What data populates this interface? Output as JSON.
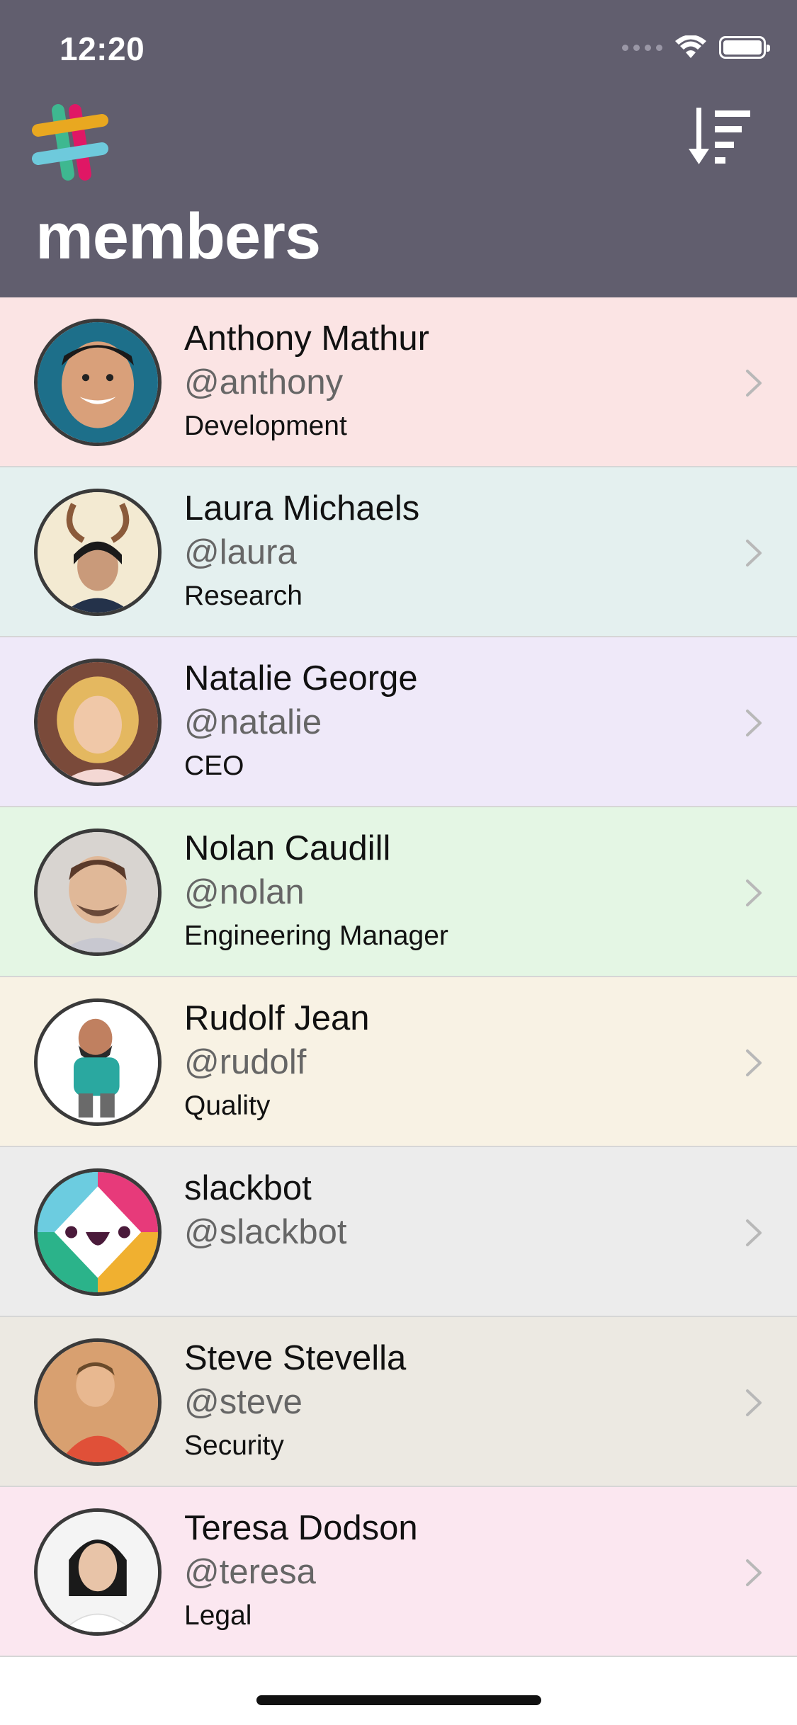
{
  "status_bar": {
    "time": "12:20"
  },
  "header": {
    "title": "members",
    "logo_icon": "slack-logo-icon",
    "sort_icon": "sort-descending-icon",
    "background": "#615e6e"
  },
  "members": [
    {
      "name": "Anthony Mathur",
      "handle": "@anthony",
      "department": "Development",
      "color": "#fbe4e4"
    },
    {
      "name": "Laura Michaels",
      "handle": "@laura",
      "department": "Research",
      "color": "#e4f0ef"
    },
    {
      "name": "Natalie George",
      "handle": "@natalie",
      "department": "CEO",
      "color": "#efe9f9"
    },
    {
      "name": "Nolan Caudill",
      "handle": "@nolan",
      "department": "Engineering Manager",
      "color": "#e4f6e4"
    },
    {
      "name": "Rudolf Jean",
      "handle": "@rudolf",
      "department": "Quality",
      "color": "#f8f2e4"
    },
    {
      "name": "slackbot",
      "handle": "@slackbot",
      "department": "",
      "color": "#ececec"
    },
    {
      "name": "Steve Stevella",
      "handle": "@steve",
      "department": "Security",
      "color": "#ece9e2"
    },
    {
      "name": "Teresa Dodson",
      "handle": "@teresa",
      "department": "Legal",
      "color": "#fbe7f0"
    }
  ]
}
